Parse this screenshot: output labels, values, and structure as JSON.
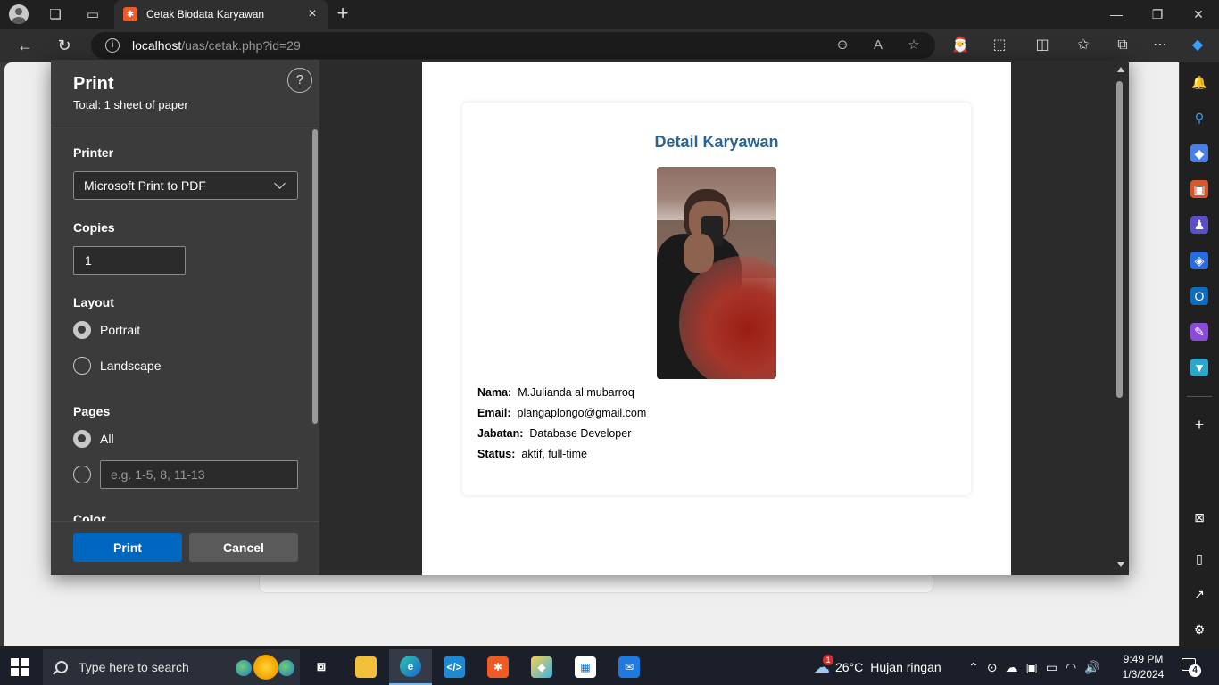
{
  "browser": {
    "tab_title": "Cetak Biodata Karyawan",
    "url_host": "localhost",
    "url_path": "/uas/cetak.php?id=29"
  },
  "print_dialog": {
    "title": "Print",
    "total": "Total: 1 sheet of paper",
    "help": "?",
    "printer_label": "Printer",
    "printer_value": "Microsoft Print to PDF",
    "copies_label": "Copies",
    "copies_value": "1",
    "layout_label": "Layout",
    "layout_options": [
      "Portrait",
      "Landscape"
    ],
    "layout_selected": "Portrait",
    "pages_label": "Pages",
    "pages_all": "All",
    "pages_placeholder": "e.g. 1-5, 8, 11-13",
    "color_label": "Color",
    "print_button": "Print",
    "cancel_button": "Cancel"
  },
  "preview": {
    "card_title": "Detail Karyawan",
    "fields": [
      {
        "label": "Nama:",
        "value": "M.Julianda al mubarroq"
      },
      {
        "label": "Email:",
        "value": "plangaplongo@gmail.com"
      },
      {
        "label": "Jabatan:",
        "value": "Database Developer"
      },
      {
        "label": "Status:",
        "value": "aktif, full-time"
      }
    ],
    "title_color": "#2a6496"
  },
  "taskbar": {
    "search_placeholder": "Type here to search",
    "weather_temp": "26°C",
    "weather_desc": "Hujan ringan",
    "weather_badge": "1",
    "time": "9:49 PM",
    "date": "1/3/2024",
    "notification_count": "4"
  },
  "colors": {
    "accent": "#0067c0",
    "panel_bg": "#3b3b3b"
  }
}
